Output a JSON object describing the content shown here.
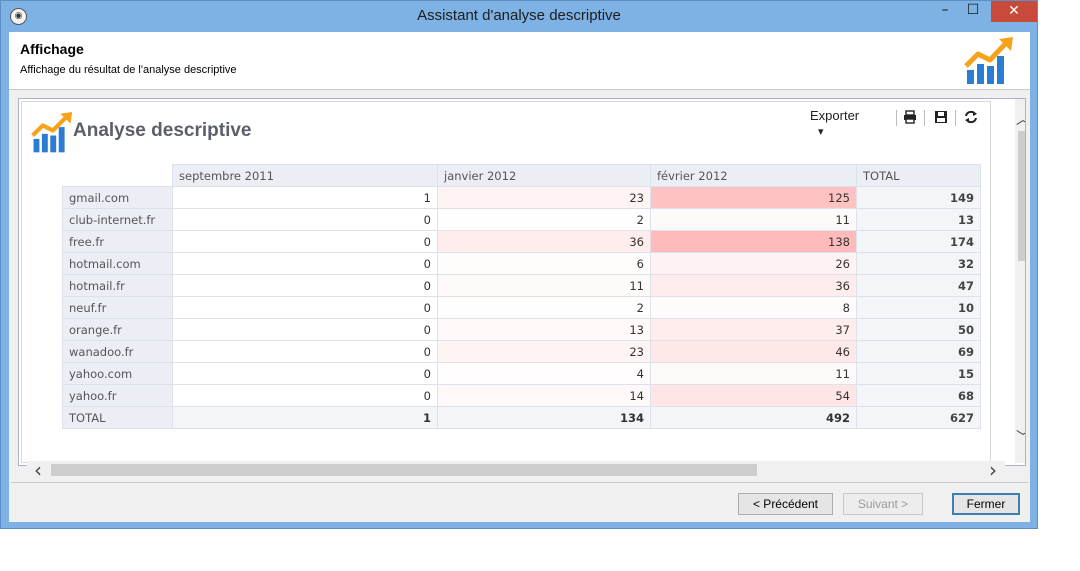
{
  "window": {
    "title": "Assistant d'analyse descriptive",
    "min_glyph": "–",
    "max_glyph": "☐",
    "close_glyph": "✕"
  },
  "header": {
    "title": "Affichage",
    "subtitle": "Affichage du résultat de l'analyse descriptive",
    "logo_icon": "chart-growth-icon"
  },
  "report": {
    "title": "Analyse descriptive",
    "toolbar": {
      "export_label": "Exporter",
      "export_arrow": "▾",
      "print_icon": "print-icon",
      "save_icon": "save-icon",
      "refresh_icon": "refresh-icon"
    },
    "columns": [
      "septembre 2011",
      "janvier 2012",
      "février 2012",
      "TOTAL"
    ],
    "rows": [
      {
        "label": "gmail.com",
        "values": [
          "1",
          "23",
          "125",
          "149"
        ]
      },
      {
        "label": "club-internet.fr",
        "values": [
          "0",
          "2",
          "11",
          "13"
        ]
      },
      {
        "label": "free.fr",
        "values": [
          "0",
          "36",
          "138",
          "174"
        ]
      },
      {
        "label": "hotmail.com",
        "values": [
          "0",
          "6",
          "26",
          "32"
        ]
      },
      {
        "label": "hotmail.fr",
        "values": [
          "0",
          "11",
          "36",
          "47"
        ]
      },
      {
        "label": "neuf.fr",
        "values": [
          "0",
          "2",
          "8",
          "10"
        ]
      },
      {
        "label": "orange.fr",
        "values": [
          "0",
          "13",
          "37",
          "50"
        ]
      },
      {
        "label": "wanadoo.fr",
        "values": [
          "0",
          "23",
          "46",
          "69"
        ]
      },
      {
        "label": "yahoo.com",
        "values": [
          "0",
          "4",
          "11",
          "15"
        ]
      },
      {
        "label": "yahoo.fr",
        "values": [
          "0",
          "14",
          "54",
          "68"
        ]
      }
    ],
    "total_row": {
      "label": "TOTAL",
      "values": [
        "1",
        "134",
        "492",
        "627"
      ]
    },
    "heat_color": "#ff9999"
  },
  "buttons": {
    "prev": "< Précédent",
    "next": "Suivant >",
    "close": "Fermer"
  },
  "scroll": {
    "up": "︿",
    "down": "﹀",
    "left": "‹",
    "right": "›"
  },
  "colors": {
    "titlebar": "#7eb1e4",
    "close": "#c74a3b",
    "logo_orange": "#f7a21b",
    "logo_blue": "#2b7cd3"
  }
}
